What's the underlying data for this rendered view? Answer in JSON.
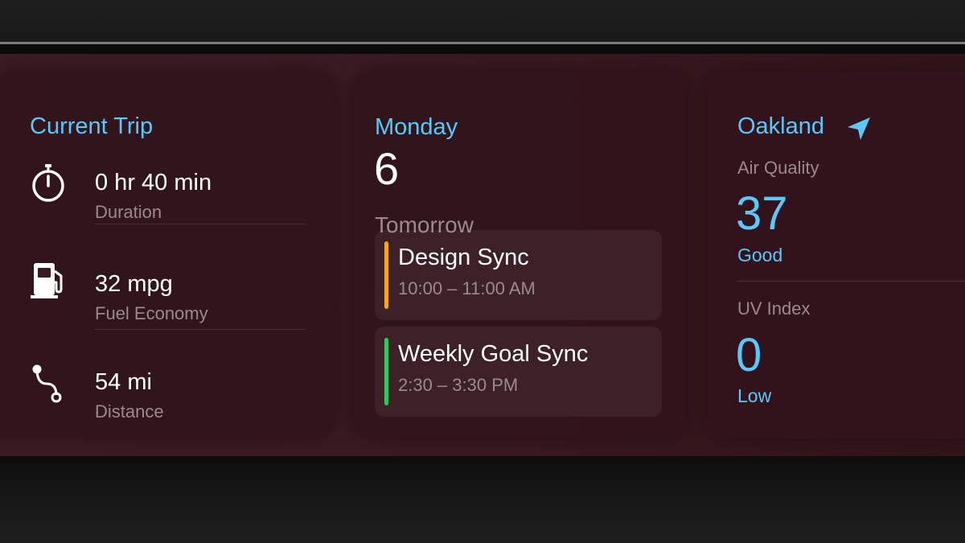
{
  "trip": {
    "title": "Current Trip",
    "stats": [
      {
        "icon": "stopwatch-icon",
        "value": "0 hr 40 min",
        "label": "Duration"
      },
      {
        "icon": "fuel-pump-icon",
        "value": "32 mpg",
        "label": "Fuel Economy"
      },
      {
        "icon": "route-icon",
        "value": "54 mi",
        "label": "Distance"
      }
    ]
  },
  "calendar": {
    "day": "Monday",
    "date": "6",
    "section": "Tomorrow",
    "events": [
      {
        "title": "Design Sync",
        "time": "10:00 – 11:00 AM",
        "color": "#f5a623"
      },
      {
        "title": "Weekly Goal Sync",
        "time": "2:30 – 3:30 PM",
        "color": "#34c759"
      }
    ]
  },
  "weather": {
    "city": "Oakland",
    "icon": "location-arrow-icon",
    "air_quality": {
      "label": "Air Quality",
      "value": "37",
      "desc": "Good"
    },
    "uv_index": {
      "label": "UV Index",
      "value": "0",
      "desc": "Low"
    }
  },
  "colors": {
    "accent": "#5ac8fa",
    "background": "#3a1a21"
  }
}
